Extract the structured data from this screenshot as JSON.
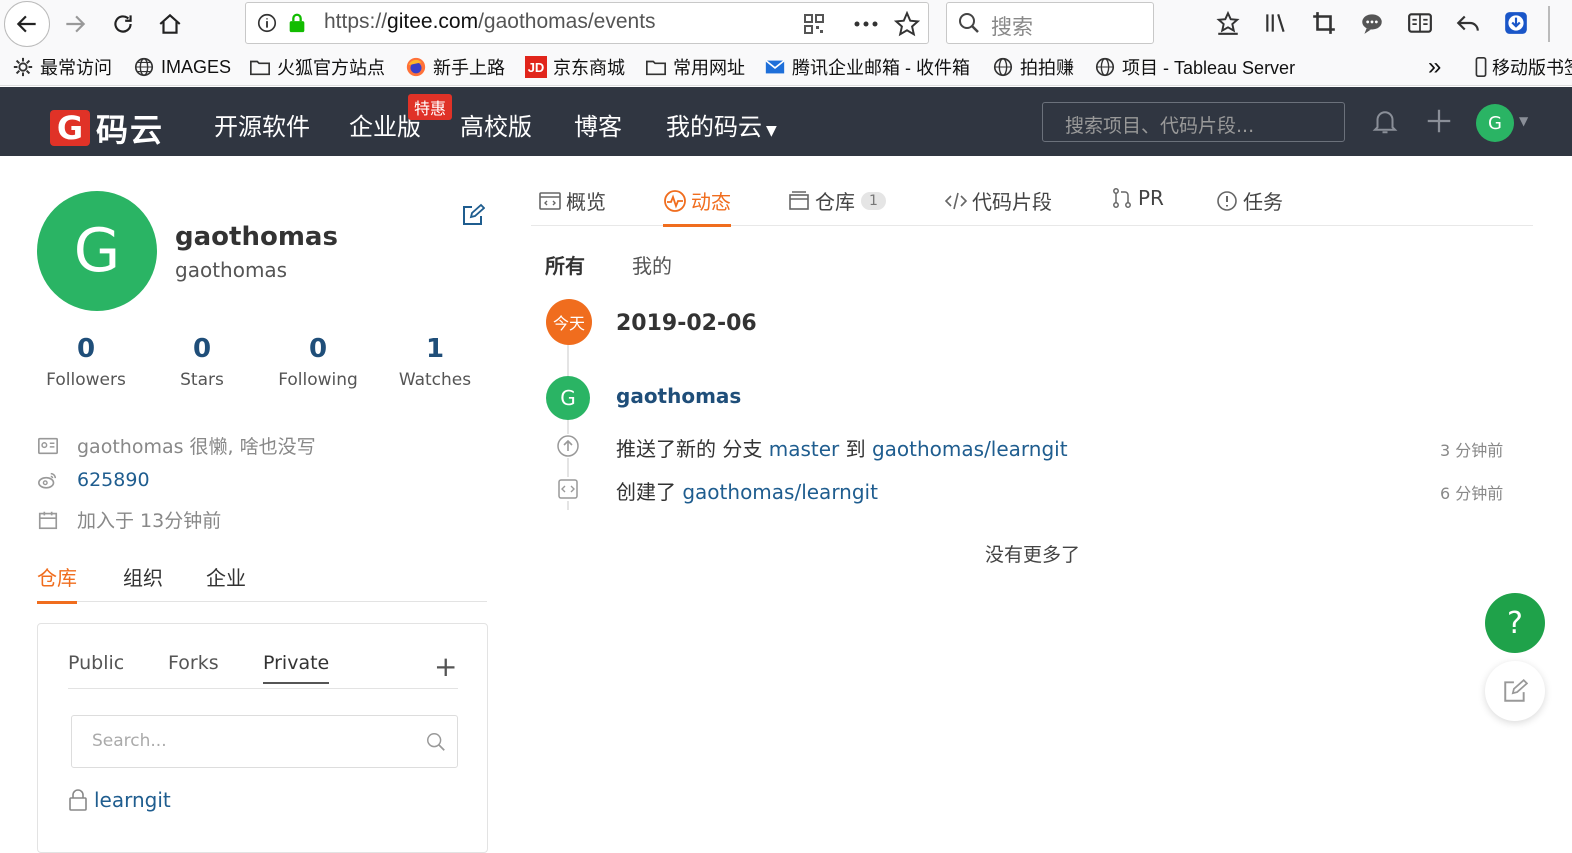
{
  "browser": {
    "url_prefix": "https://",
    "url_host": "gitee.com",
    "url_path": "/gaothomas/events",
    "search_placeholder": "搜索",
    "overflow_label": "»",
    "bookmarks": [
      {
        "label": "最常访问",
        "icon": "gear-icon"
      },
      {
        "label": "IMAGES",
        "icon": "globe-icon"
      },
      {
        "label": "火狐官方站点",
        "icon": "folder-icon"
      },
      {
        "label": "新手上路",
        "icon": "firefox-icon"
      },
      {
        "label": "京东商城",
        "icon": "jd-icon"
      },
      {
        "label": "常用网址",
        "icon": "folder-icon"
      },
      {
        "label": "腾讯企业邮箱 - 收件箱",
        "icon": "mail-icon"
      },
      {
        "label": "拍拍赚",
        "icon": "globe-icon"
      },
      {
        "label": "项目 - Tableau Server",
        "icon": "globe-icon"
      },
      {
        "label": "移动版书签",
        "icon": "mobile-icon"
      }
    ],
    "jd_logo_text": "JD"
  },
  "header": {
    "logo_mark": "G",
    "logo_text": "码云",
    "nav": [
      "开源软件",
      "企业版",
      "高校版",
      "博客",
      "我的码云"
    ],
    "promo_badge": "特惠",
    "search_placeholder": "搜索项目、代码片段...",
    "avatar_letter": "G",
    "colors": {
      "bg": "#303641",
      "brand": "#e03227"
    }
  },
  "profile": {
    "avatar_letter": "G",
    "display_name": "gaothomas",
    "username": "gaothomas",
    "stats": [
      {
        "value": "0",
        "label": "Followers"
      },
      {
        "value": "0",
        "label": "Stars"
      },
      {
        "value": "0",
        "label": "Following"
      },
      {
        "value": "1",
        "label": "Watches"
      }
    ],
    "bio": "gaothomas 很懒, 啥也没写",
    "weibo": "625890",
    "joined": "加入于 13分钟前"
  },
  "left_tabs": [
    "仓库",
    "组织",
    "企业"
  ],
  "repo_panel": {
    "tabs": [
      "Public",
      "Forks",
      "Private"
    ],
    "add_label": "+",
    "search_placeholder": "Search...",
    "repos": [
      "learngit"
    ]
  },
  "main_tabs": [
    {
      "label": "概览",
      "icon": "overview-icon"
    },
    {
      "label": "动态",
      "icon": "activity-icon"
    },
    {
      "label": "仓库",
      "icon": "repo-icon",
      "badge": "1"
    },
    {
      "label": "代码片段",
      "icon": "code-icon"
    },
    {
      "label": "PR",
      "icon": "pull-request-icon"
    },
    {
      "label": "任务",
      "icon": "issue-icon"
    }
  ],
  "filters": [
    "所有",
    "我的"
  ],
  "feed": {
    "today_label": "今天",
    "date": "2019-02-06",
    "avatar_letter": "G",
    "user": "gaothomas",
    "events": [
      {
        "prefix": "推送了新的 分支 ",
        "branch": "master",
        "mid": " 到 ",
        "repo": "gaothomas/learngit",
        "time": "3 分钟前"
      },
      {
        "prefix": "创建了 ",
        "repo": "gaothomas/learngit",
        "time": "6 分钟前"
      }
    ],
    "no_more": "没有更多了"
  },
  "fab": {
    "help_label": "?"
  }
}
